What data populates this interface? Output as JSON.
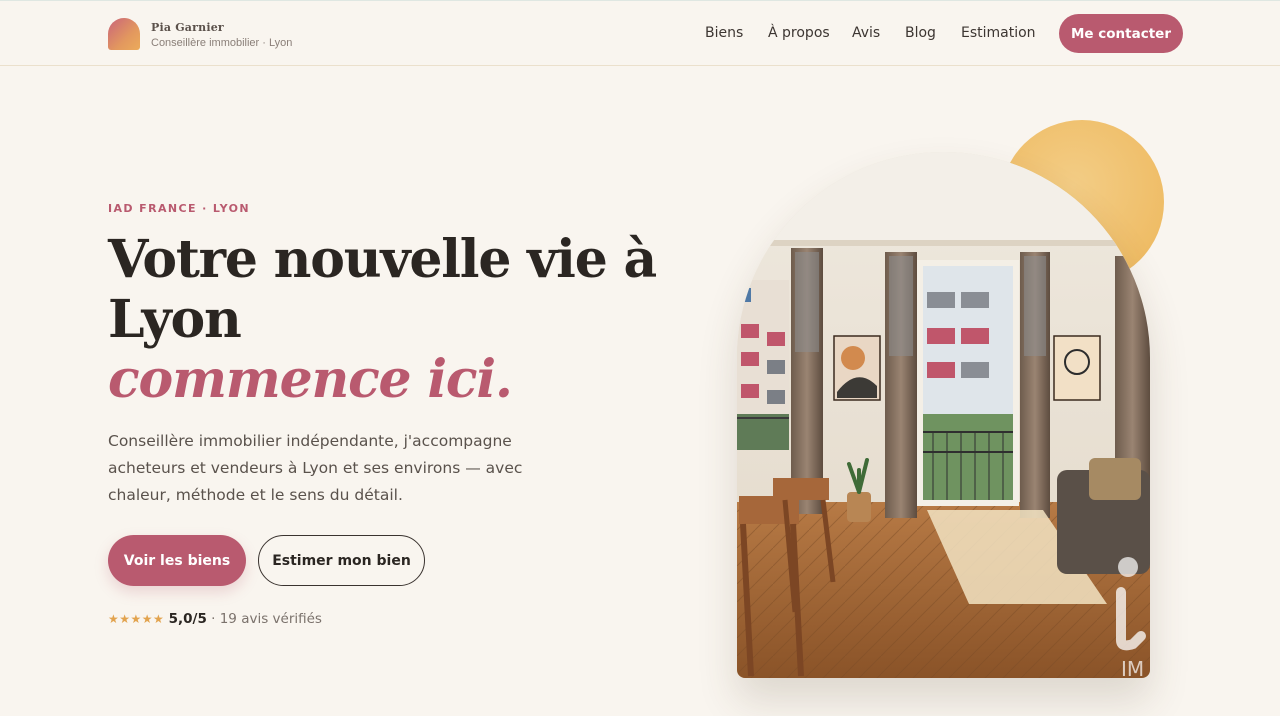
{
  "brand": {
    "name": "Pia Garnier",
    "subtitle": "Conseillère immobilier · Lyon"
  },
  "nav": {
    "links": [
      "Biens",
      "À propos",
      "Avis",
      "Blog",
      "Estimation"
    ],
    "cta": "Me contacter"
  },
  "hero": {
    "eyebrow": "IAD FRANCE · LYON",
    "title_line1": "Votre nouvelle vie à",
    "title_line2": "Lyon",
    "title_accent": "commence ici.",
    "lead": "Conseillère immobilier indépendante, j'accompagne acheteurs et vendeurs à Lyon et ses environs — avec chaleur, méthode et le sens du détail.",
    "primary_button": "Voir les biens",
    "secondary_button": "Estimer mon bien",
    "rating_stars": "★★★★★",
    "rating_score": "5,0/5",
    "rating_text": "· 19 avis vérifiés",
    "rating_value": 5
  },
  "colors": {
    "background": "#f9f5ef",
    "accent": "#b95a6f",
    "sun": "#efbd67",
    "text": "#2b2622"
  },
  "photo_watermark": "IM"
}
